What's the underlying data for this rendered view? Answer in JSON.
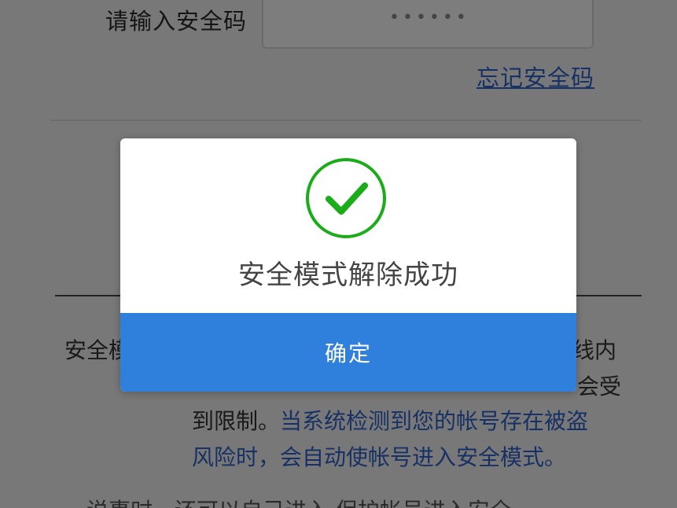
{
  "form": {
    "code_label": "请输入安全码",
    "code_placeholder": "••••••",
    "forgot_link": "忘记安全码"
  },
  "info": {
    "label_fragment": "安全模",
    "right_fragment_1": "线内",
    "right_fragment_2": "会受",
    "line3_dark": "到限制。",
    "line3_blue": "当系统检测到您的帐号存在被盗",
    "line4": "风险时，会自动使帐号进入安全模式。",
    "line5": "说事时，还可以自己进入 保护帐号进入安全"
  },
  "dialog": {
    "icon": "check-circle-icon",
    "message": "安全模式解除成功",
    "confirm_label": "确定"
  },
  "colors": {
    "accent_blue": "#2f80dc",
    "link_blue": "#2f62c8",
    "success_green": "#1aad19"
  }
}
